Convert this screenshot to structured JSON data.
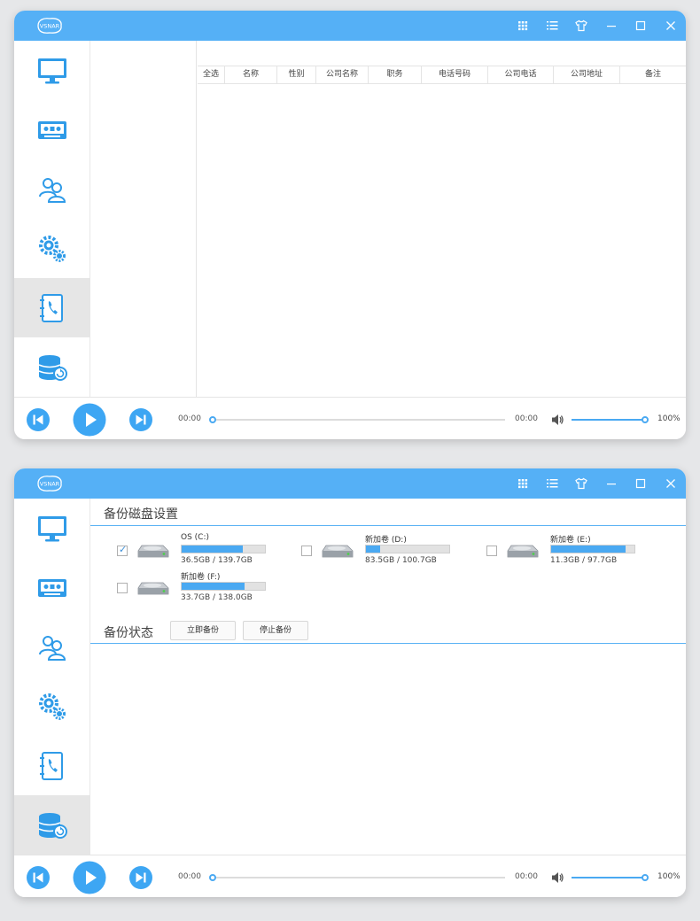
{
  "app": {
    "logo_text": "VSNAR"
  },
  "colors": {
    "accent": "#55b0f6",
    "active_item": "#e6e6e6",
    "bar_fill": "#4aa9f2"
  },
  "titlebar_icons": [
    "grid-icon",
    "list-icon",
    "shirt-icon",
    "minimize-icon",
    "maximize-icon",
    "close-icon"
  ],
  "sidebar_items": [
    {
      "icon": "monitor-icon"
    },
    {
      "icon": "cassette-icon"
    },
    {
      "icon": "users-icon"
    },
    {
      "icon": "gears-icon"
    },
    {
      "icon": "contacts-icon"
    },
    {
      "icon": "database-backup-icon"
    }
  ],
  "window1": {
    "active_sidebar_index": 4,
    "table": {
      "columns": [
        "全选",
        "名称",
        "性别",
        "公司名称",
        "职务",
        "电话号码",
        "公司电话",
        "公司地址",
        "备注"
      ],
      "rows": []
    },
    "player": {
      "time_current": "00:00",
      "time_total": "00:00",
      "progress": 0,
      "volume": "100%"
    }
  },
  "window2": {
    "active_sidebar_index": 5,
    "backup_settings_title": "备份磁盘设置",
    "disks": [
      {
        "name": "OS (C:)",
        "size": "36.5GB / 139.7GB",
        "used_fraction": 0.73,
        "checked": true
      },
      {
        "name": "新加卷 (D:)",
        "size": "83.5GB / 100.7GB",
        "used_fraction": 0.17,
        "checked": false
      },
      {
        "name": "新加卷 (E:)",
        "size": "11.3GB / 97.7GB",
        "used_fraction": 0.89,
        "checked": false
      },
      {
        "name": "新加卷 (F:)",
        "size": "33.7GB / 138.0GB",
        "used_fraction": 0.76,
        "checked": false
      }
    ],
    "backup_status_title": "备份状态",
    "buttons": {
      "start": "立即备份",
      "stop": "停止备份"
    },
    "player": {
      "time_current": "00:00",
      "time_total": "00:00",
      "progress": 0,
      "volume": "100%"
    }
  }
}
